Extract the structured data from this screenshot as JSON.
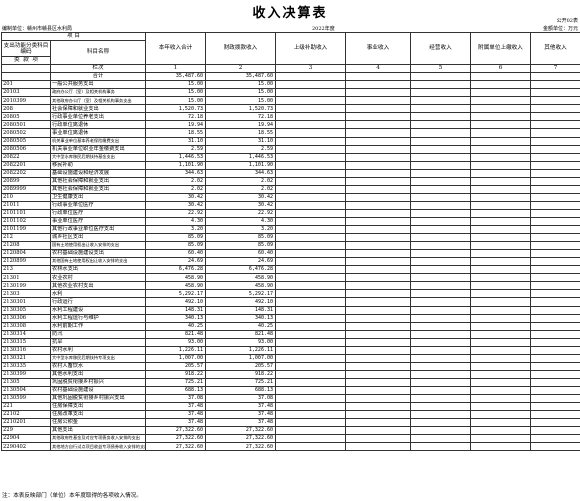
{
  "title": "收入决算表",
  "form_code": "公开02表",
  "unit_label": "编制单位：赣州市赣县区水利局",
  "year": "2022年度",
  "amount_unit": "金额单位：万元",
  "headers": {
    "project": "项   目",
    "func_code": "支出功能分类科目编码",
    "subject_name": "科目名称",
    "lei": "类",
    "kuan": "款",
    "xiang": "项",
    "col1": "本年收入合计",
    "col2": "财政拨款收入",
    "col3": "上级补助收入",
    "col4": "事业收入",
    "col5": "经营收入",
    "col6": "附属单位上缴收入",
    "col7": "其他收入",
    "row_label": "栏次",
    "n1": "1",
    "n2": "2",
    "n3": "3",
    "n4": "4",
    "n5": "5",
    "n6": "6",
    "n7": "7"
  },
  "rows": [
    {
      "code": "",
      "name": "合计",
      "total": "35,487.60",
      "fiscal": "35,487.60"
    },
    {
      "code": "201",
      "name": "一般公共服务支出",
      "total": "15.00",
      "fiscal": "15.00"
    },
    {
      "code": "20103",
      "name": "政府办公厅（室）及相关机构事务",
      "total": "15.00",
      "fiscal": "15.00"
    },
    {
      "code": "2010399",
      "name": "其他政府办公厅（室）及相关机构事务支出",
      "total": "15.00",
      "fiscal": "15.00"
    },
    {
      "code": "208",
      "name": "社会保障和就业支出",
      "total": "1,520.73",
      "fiscal": "1,520.73"
    },
    {
      "code": "20805",
      "name": "行政事业单位养老支出",
      "total": "72.18",
      "fiscal": "72.18"
    },
    {
      "code": "2080501",
      "name": "行政单位离退休",
      "total": "19.94",
      "fiscal": "19.94"
    },
    {
      "code": "2080502",
      "name": "事业单位离退休",
      "total": "18.55",
      "fiscal": "18.55"
    },
    {
      "code": "2080505",
      "name": "机关事业单位基本养老保险缴费支出",
      "total": "31.10",
      "fiscal": "31.10"
    },
    {
      "code": "2080506",
      "name": "机关事业单位职业年金缴费支出",
      "total": "2.59",
      "fiscal": "2.59"
    },
    {
      "code": "20822",
      "name": "大中型水库移民后期扶持基金支出",
      "total": "1,446.53",
      "fiscal": "1,446.53"
    },
    {
      "code": "2082201",
      "name": "移民补助",
      "total": "1,101.90",
      "fiscal": "1,101.90"
    },
    {
      "code": "2082202",
      "name": "基础设施建设和经济发展",
      "total": "344.63",
      "fiscal": "344.63"
    },
    {
      "code": "20899",
      "name": "其他社会保障和就业支出",
      "total": "2.02",
      "fiscal": "2.02"
    },
    {
      "code": "2089999",
      "name": "其他社会保障和就业支出",
      "total": "2.02",
      "fiscal": "2.02"
    },
    {
      "code": "210",
      "name": "卫生健康支出",
      "total": "30.42",
      "fiscal": "30.42"
    },
    {
      "code": "21011",
      "name": "行政事业单位医疗",
      "total": "30.42",
      "fiscal": "30.42"
    },
    {
      "code": "2101101",
      "name": "行政单位医疗",
      "total": "22.92",
      "fiscal": "22.92"
    },
    {
      "code": "2101102",
      "name": "事业单位医疗",
      "total": "4.30",
      "fiscal": "4.30"
    },
    {
      "code": "2101199",
      "name": "其他行政事业单位医疗支出",
      "total": "3.20",
      "fiscal": "3.20"
    },
    {
      "code": "212",
      "name": "城乡社区支出",
      "total": "85.09",
      "fiscal": "85.09"
    },
    {
      "code": "21208",
      "name": "国有土地使用权出让收入安排的支出",
      "total": "85.09",
      "fiscal": "85.09"
    },
    {
      "code": "2120804",
      "name": "农村基础设施建设支出",
      "total": "60.40",
      "fiscal": "60.40"
    },
    {
      "code": "2120899",
      "name": "其他国有土地使用权出让收入安排的支出",
      "total": "24.69",
      "fiscal": "24.69"
    },
    {
      "code": "213",
      "name": "农林水支出",
      "total": "6,476.28",
      "fiscal": "6,476.28"
    },
    {
      "code": "21301",
      "name": "农业农村",
      "total": "458.90",
      "fiscal": "458.90"
    },
    {
      "code": "2130199",
      "name": "其他农业农村支出",
      "total": "458.90",
      "fiscal": "458.90"
    },
    {
      "code": "21303",
      "name": "水利",
      "total": "5,292.17",
      "fiscal": "5,292.17"
    },
    {
      "code": "2130301",
      "name": "行政运行",
      "total": "492.10",
      "fiscal": "492.10"
    },
    {
      "code": "2130305",
      "name": "水利工程建设",
      "total": "148.31",
      "fiscal": "148.31"
    },
    {
      "code": "2130306",
      "name": "水利工程运行与维护",
      "total": "340.13",
      "fiscal": "340.13"
    },
    {
      "code": "2130308",
      "name": "水利前期工作",
      "total": "40.25",
      "fiscal": "40.25"
    },
    {
      "code": "2130314",
      "name": "防汛",
      "total": "821.48",
      "fiscal": "821.48"
    },
    {
      "code": "2130315",
      "name": "抗旱",
      "total": "93.00",
      "fiscal": "93.00"
    },
    {
      "code": "2130316",
      "name": "农村水利",
      "total": "1,226.11",
      "fiscal": "1,226.11"
    },
    {
      "code": "2130321",
      "name": "大中型水库移民后期扶持专项支出",
      "total": "1,007.00",
      "fiscal": "1,007.00"
    },
    {
      "code": "2130335",
      "name": "农村人畜饮水",
      "total": "205.57",
      "fiscal": "205.57"
    },
    {
      "code": "2130399",
      "name": "其他水利支出",
      "total": "918.22",
      "fiscal": "918.22"
    },
    {
      "code": "21305",
      "name": "巩固脱贫衔接乡村振兴",
      "total": "725.21",
      "fiscal": "725.21"
    },
    {
      "code": "2130504",
      "name": "农村基础设施建设",
      "total": "688.13",
      "fiscal": "688.13"
    },
    {
      "code": "2130599",
      "name": "其他巩固脱贫衔接乡村振兴支出",
      "total": "37.08",
      "fiscal": "37.08"
    },
    {
      "code": "221",
      "name": "住房保障支出",
      "total": "37.48",
      "fiscal": "37.48"
    },
    {
      "code": "22102",
      "name": "住房改革支出",
      "total": "37.48",
      "fiscal": "37.48"
    },
    {
      "code": "2210201",
      "name": "住房公积金",
      "total": "37.48",
      "fiscal": "37.48"
    },
    {
      "code": "229",
      "name": "其他支出",
      "total": "27,322.60",
      "fiscal": "27,322.60"
    },
    {
      "code": "22904",
      "name": "其他政府性基金及对应专项债务收入安排的支出",
      "total": "27,322.60",
      "fiscal": "27,322.60"
    },
    {
      "code": "2290402",
      "name": "其他地方自行试点项目收益专项债券收入安排的支出",
      "total": "27,322.60",
      "fiscal": "27,322.60"
    }
  ],
  "footnote": "注：本表反映部门（单位）本年度取得的各项收入情况。"
}
